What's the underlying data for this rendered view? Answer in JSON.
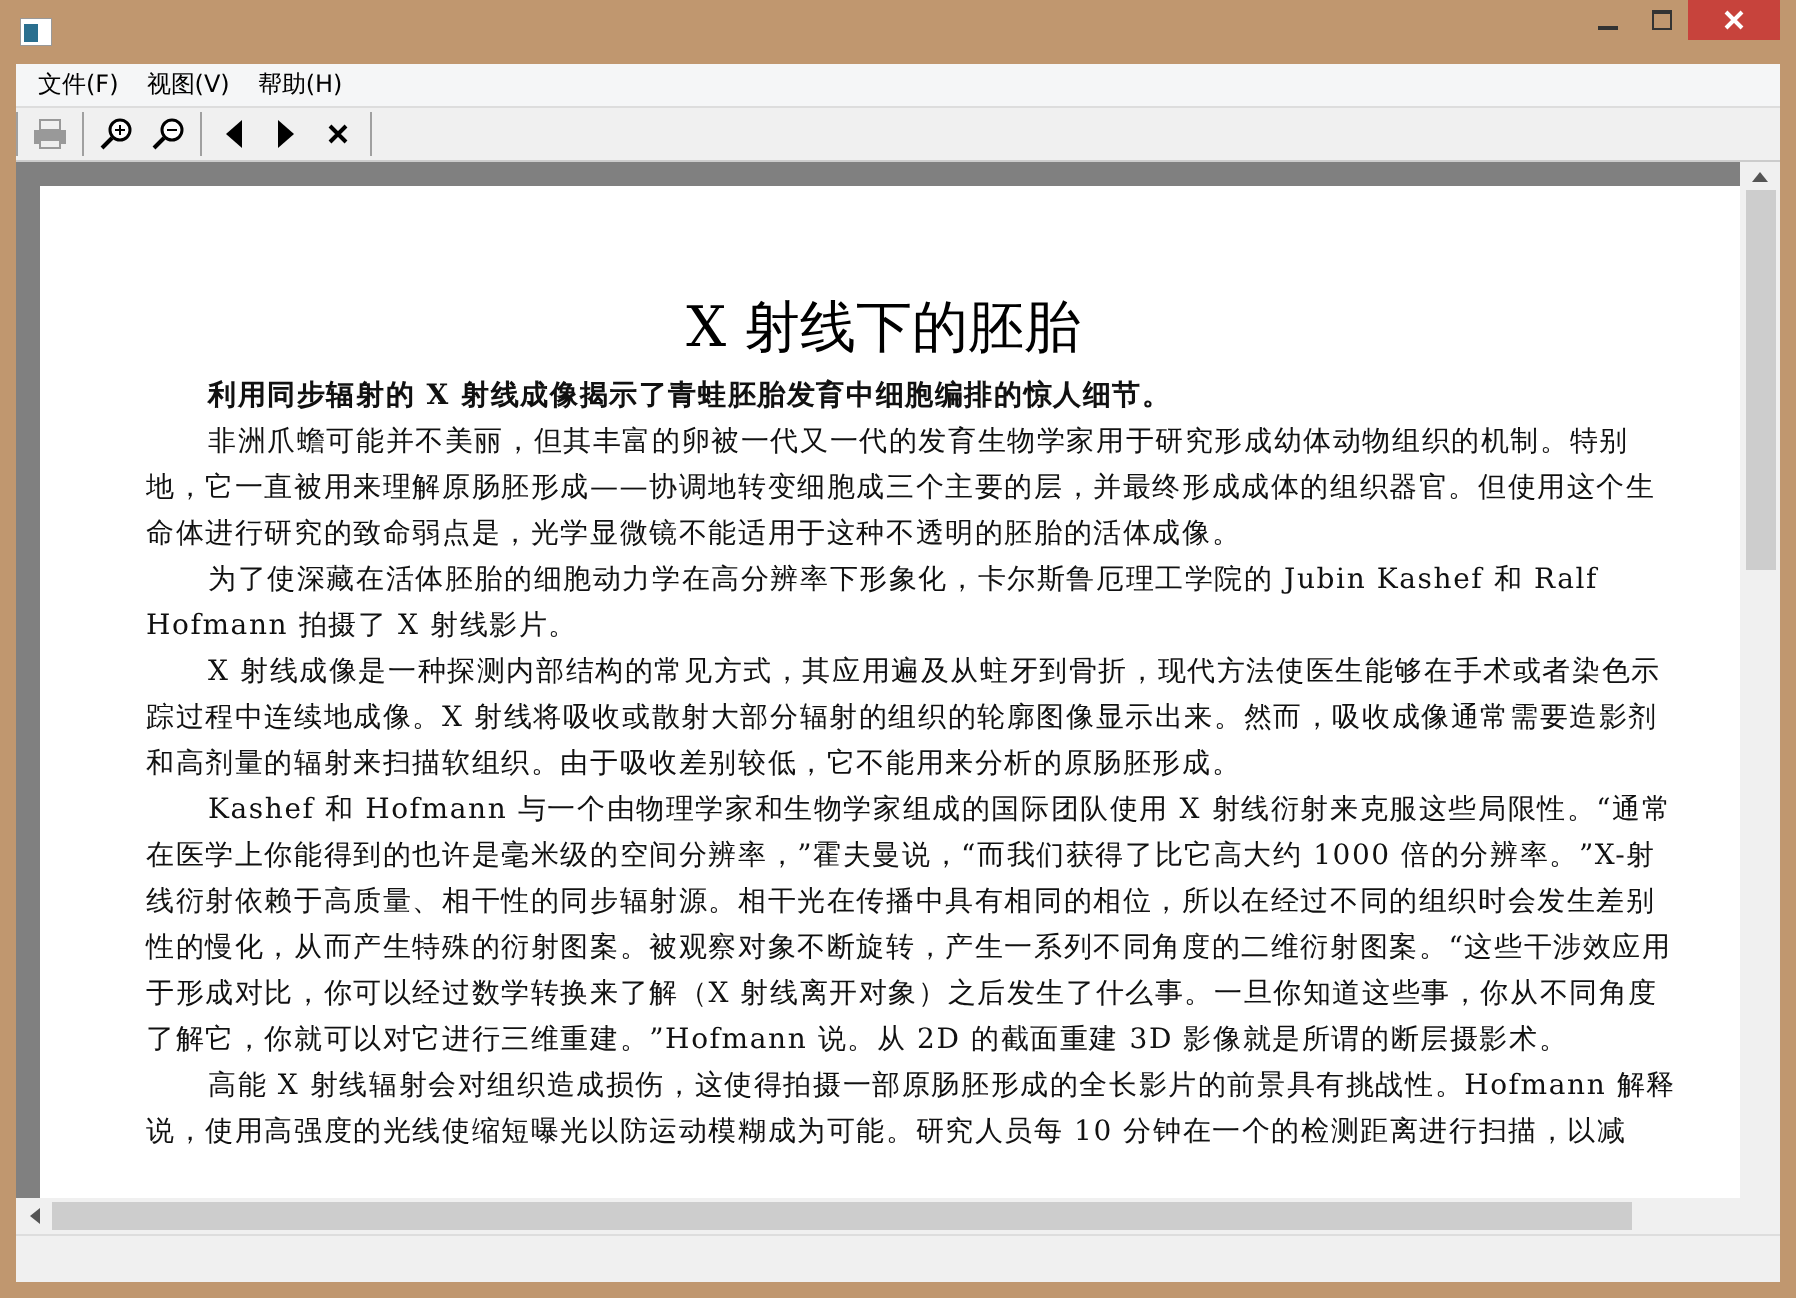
{
  "menu": [
    "文件(F)",
    "视图(V)",
    "帮助(H)"
  ],
  "toolbar": [
    {
      "kind": "print",
      "disabled": true
    },
    {
      "kind": "zoom-in",
      "disabled": false
    },
    {
      "kind": "zoom-out",
      "disabled": false
    },
    {
      "kind": "prev",
      "disabled": false
    },
    {
      "kind": "next",
      "disabled": false
    },
    {
      "kind": "close",
      "disabled": false
    }
  ],
  "document": {
    "title": "X 射线下的胚胎",
    "lead": "利用同步辐射的 X 射线成像揭示了青蛙胚胎发育中细胞编排的惊人细节。",
    "paragraphs": [
      "非洲爪蟾可能并不美丽，但其丰富的卵被一代又一代的发育生物学家用于研究形成幼体动物组织的机制。特别地，它一直被用来理解原肠胚形成——协调地转变细胞成三个主要的层，并最终形成成体的组织器官。但使用这个生命体进行研究的致命弱点是，光学显微镜不能适用于这种不透明的胚胎的活体成像。",
      "为了使深藏在活体胚胎的细胞动力学在高分辨率下形象化，卡尔斯鲁厄理工学院的 Jubin Kashef 和 Ralf Hofmann 拍摄了 X 射线影片。",
      "X 射线成像是一种探测内部结构的常见方式，其应用遍及从蛀牙到骨折，现代方法使医生能够在手术或者染色示踪过程中连续地成像。X 射线将吸收或散射大部分辐射的组织的轮廓图像显示出来。然而，吸收成像通常需要造影剂和高剂量的辐射来扫描软组织。由于吸收差别较低，它不能用来分析的原肠胚形成。",
      "Kashef 和 Hofmann 与一个由物理学家和生物学家组成的国际团队使用 X 射线衍射来克服这些局限性。“通常在医学上你能得到的也许是毫米级的空间分辨率，”霍夫曼说，“而我们获得了比它高大约 1000 倍的分辨率。”X-射线衍射依赖于高质量、相干性的同步辐射源。相干光在传播中具有相同的相位，所以在经过不同的组织时会发生差别性的慢化，从而产生特殊的衍射图案。被观察对象不断旋转，产生一系列不同角度的二维衍射图案。“这些干涉效应用于形成对比，你可以经过数学转换来了解（X 射线离开对象）之后发生了什么事。一旦你知道这些事，你从不同角度了解它，你就可以对它进行三维重建。”Hofmann 说。从 2D 的截面重建 3D 影像就是所谓的断层摄影术。",
      "高能 X 射线辐射会对组织造成损伤，这使得拍摄一部原肠胚形成的全长影片的前景具有挑战性。Hofmann 解释说，使用高强度的光线使缩短曝光以防运动模糊成为可能。研究人员每 10 分钟在一个的检测距离进行扫描，以减"
    ]
  }
}
